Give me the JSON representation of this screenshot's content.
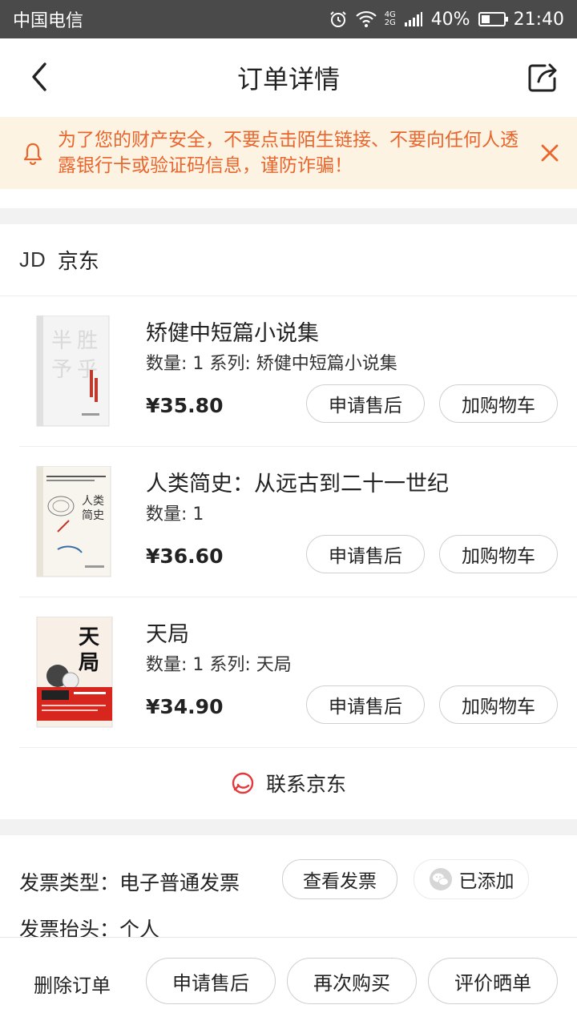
{
  "status_bar": {
    "carrier": "中国电信",
    "network": "4G 2G",
    "battery": "40%",
    "battery_level": 0.4,
    "time": "21:40"
  },
  "header": {
    "title": "订单详情"
  },
  "notice": {
    "text": "为了您的财产安全，不要点击陌生链接、不要向任何人透露银行卡或验证码信息，谨防诈骗！",
    "color": "#e8662d"
  },
  "shop": {
    "logo": "JD",
    "name": "京东",
    "items": [
      {
        "name": "矫健中短篇小说集",
        "meta": "数量: 1 系列: 矫健中短篇小说集",
        "price": "¥35.80",
        "aftersale_label": "申请售后",
        "cart_label": "加购物车"
      },
      {
        "name": "人类简史：从远古到二十一世纪",
        "meta": "数量: 1",
        "price": "¥36.60",
        "aftersale_label": "申请售后",
        "cart_label": "加购物车"
      },
      {
        "name": "天局",
        "meta": "数量: 1 系列: 天局",
        "price": "¥34.90",
        "aftersale_label": "申请售后",
        "cart_label": "加购物车"
      }
    ],
    "contact_label": "联系京东"
  },
  "invoice": {
    "type_label": "发票类型：电子普通发票",
    "view_label": "查看发票",
    "added_label": "已添加",
    "title_label": "发票抬头：个人"
  },
  "bottom_bar": {
    "delete_label": "删除订单",
    "aftersale_label": "申请售后",
    "rebuy_label": "再次购买",
    "review_label": "评价晒单"
  },
  "colors": {
    "accent": "#e8662d",
    "jd_red": "#e4393c",
    "notice_bg": "#fdf3e3"
  }
}
